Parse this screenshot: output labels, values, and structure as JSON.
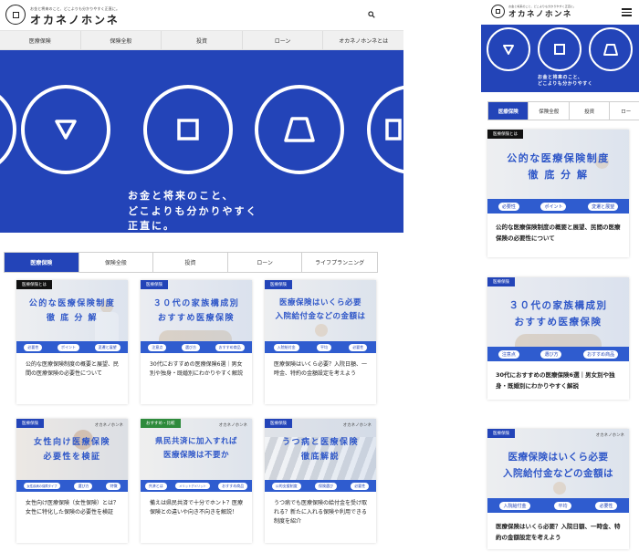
{
  "brand": {
    "tagline": "お金と将来のこと、どこよりも分かりやすく正直に。",
    "name": "オカネノホンネ",
    "colors": {
      "primary": "#2344b8",
      "thumb_text": "#2f57c8"
    }
  },
  "header": {
    "search_icon": "search-icon",
    "menu_icon": "hamburger-icon"
  },
  "nav": [
    {
      "label": "医療保険"
    },
    {
      "label": "保険全般"
    },
    {
      "label": "投資"
    },
    {
      "label": "ローン"
    },
    {
      "label": "オカネノホンネとは"
    }
  ],
  "hero": {
    "line1": "お金と将来のこと、",
    "line2": "どこよりも分かりやすく",
    "line3": "正直に。"
  },
  "mobile_hero": {
    "line1": "お金と将来のこと、",
    "line2": "どこよりも分かりやすく"
  },
  "tabs": [
    {
      "label": "医療保険",
      "active": true
    },
    {
      "label": "保険全般",
      "active": false
    },
    {
      "label": "投資",
      "active": false
    },
    {
      "label": "ローン",
      "active": false
    },
    {
      "label": "ライフプランニング",
      "active": false
    }
  ],
  "mobile_tabs": [
    {
      "label": "医療保険",
      "active": true
    },
    {
      "label": "保険全般",
      "active": false
    },
    {
      "label": "投資",
      "active": false
    },
    {
      "label": "ロー",
      "active": false
    }
  ],
  "articles": [
    {
      "badge": "医療保険とは",
      "thumb_line1": "公的な医療保険制度",
      "thumb_line2": "徹 底 分 解",
      "pills": [
        "必要性",
        "ポイント",
        "変遷と展望"
      ],
      "title": "公的な医療保険制度の概要と展望、民間の医療保険の必要性について"
    },
    {
      "badge": "医療保険",
      "thumb_line1": "３０代の家族構成別",
      "thumb_line2": "おすすめ医療保険",
      "pills": [
        "注意点",
        "選び方",
        "おすすめ商品"
      ],
      "title": "30代におすすめの医療保険6選｜男女別や独身・既婚別にわかりやすく解説"
    },
    {
      "badge": "医療保険",
      "thumb_line1": "医療保険はいくら必要",
      "thumb_line2": "入院給付金などの金額は",
      "pills": [
        "入院給付金",
        "平均",
        "必要性"
      ],
      "title": "医療保険はいくら必要？入院日額、一時金、特約の金額設定を考えよう"
    },
    {
      "badge": "医療保険",
      "watermark": "オカネノホンネ",
      "thumb_line1": "女性向け医療保険",
      "thumb_line2": "必要性を検証",
      "pills": [
        "女性疾病の保障タイプ",
        "選び方",
        "特徴"
      ],
      "title": "女性向け医療保険（女性保険）とは？女性に特化した保険の必要性を検証"
    },
    {
      "badge": "おすすめ・比較",
      "watermark": "オカネノホンネ",
      "thumb_line1": "県民共済に加入すれば",
      "thumb_line2": "医療保険は不要か",
      "pills": [
        "共済とは",
        "メリットデメリット",
        "おすすめ商品"
      ],
      "title": "備えは県民共済で十分でホント？医療保険との違いや向き不向きを解説！"
    },
    {
      "badge": "医療保険",
      "watermark": "オカネノホンネ",
      "thumb_line1": "うつ病と医療保険",
      "thumb_line2": "徹底解説",
      "pills": [
        "公的支援制度",
        "保険選び",
        "必要性"
      ],
      "title": "うつ病でも医療保険の給付金を受け取れる？新たに入れる保険や利用できる制度を紹介"
    }
  ],
  "mobile_articles": [
    {
      "badge": "医療保険とは",
      "thumb_line1": "公的な医療保険制度",
      "thumb_line2": "徹 底 分 解",
      "pills": [
        "必要性",
        "ポイント",
        "変遷と展望"
      ],
      "title": "公的な医療保険制度の概要と展望、民間の医療保険の必要性について"
    },
    {
      "badge": "医療保険",
      "thumb_line1": "３０代の家族構成別",
      "thumb_line2": "おすすめ医療保険",
      "pills": [
        "注意点",
        "選び方",
        "おすすめ商品"
      ],
      "title": "30代におすすめの医療保険6選｜男女別や独身・既婚別にわかりやすく解説"
    },
    {
      "badge": "医療保険",
      "watermark": "オカネノホンネ",
      "thumb_line1": "医療保険はいくら必要",
      "thumb_line2": "入院給付金などの金額は",
      "pills": [
        "入院給付金",
        "平均",
        "必要性"
      ],
      "title": "医療保険はいくら必要？入院日額、一時金、特約の金額設定を考えよう"
    }
  ]
}
